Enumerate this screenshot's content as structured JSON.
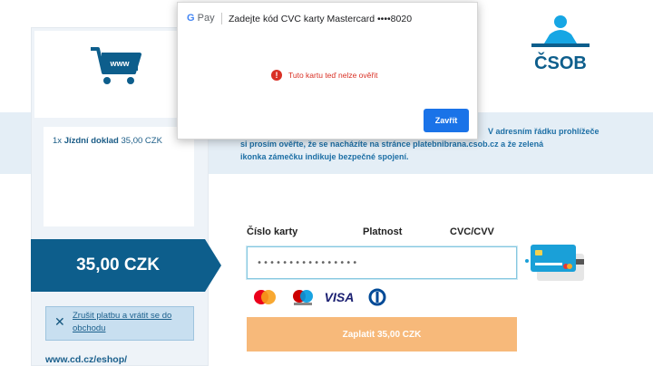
{
  "colors": {
    "brand_blue": "#0d5e8c",
    "info_text": "#1d6fa5",
    "pay_button": "#f7b97a",
    "error_red": "#d93025",
    "google_blue": "#1a73e8"
  },
  "merchant": {
    "logo_text": "www",
    "logo_icon": "shopping-cart-icon"
  },
  "order": {
    "quantity": "1x",
    "item_name": "Jízdní doklad",
    "item_price": "35,00 CZK"
  },
  "total": {
    "amount": "35,00 CZK"
  },
  "cancel": {
    "icon": "close-icon",
    "label": "Zrušit platbu a vrátit se do obchodu"
  },
  "eshop_link": "www.cd.cz/eshop/",
  "bank": {
    "name": "ČSOB"
  },
  "info_banner": {
    "line1": "V adresním řádku prohlížeče",
    "line2": "si prosím ověřte, že se nacházíte na stránce platebnibrana.csob.cz a že zelená",
    "line3": "ikonka zámečku indikuje bezpečné spojení."
  },
  "form": {
    "card_number_label": "Číslo karty",
    "expiry_label": "Platnost",
    "cvc_label": "CVC/CVV",
    "card_number_value": "••••••••••••••••",
    "pay_button_label": "Zaplatit 35,00 CZK"
  },
  "card_brands": [
    "mastercard",
    "maestro",
    "VISA",
    "diners-club"
  ],
  "google_pay": {
    "logo_g": "G",
    "logo_text": "Pay",
    "title": "Zadejte kód CVC karty Mastercard  ••••8020",
    "error_message": "Tuto kartu teď nelze ověřit",
    "close_button": "Zavřít"
  }
}
